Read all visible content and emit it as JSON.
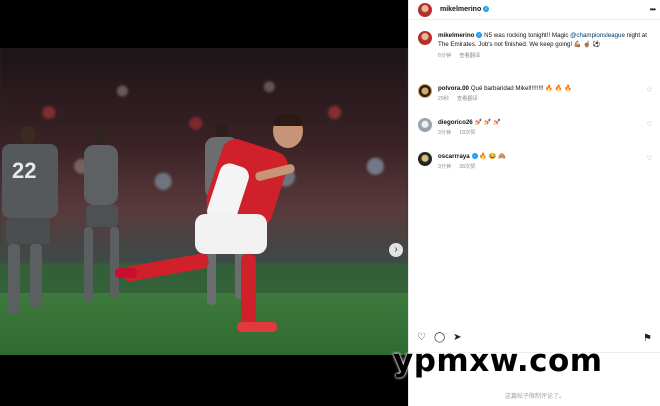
{
  "post": {
    "author": "mikelmerino",
    "caption_author": "mikelmerino",
    "caption_part1": " N5 was rocking tonight!! Magic ",
    "caption_mention": "@championsleague",
    "caption_part2": " night at The Emirates. Job's not finished. We keep going! 💪🏽 ☝🏽 ⚽",
    "caption_time": "6分钟",
    "caption_translate": "查看翻译",
    "media_slides": 4,
    "active_slide": 2
  },
  "comments": [
    {
      "user": "polvora.00",
      "text": "Qué barbaridad Mikel!!!!!!!! 🔥 🔥 🔥",
      "time": "29秒",
      "extra": "查看翻译",
      "verified": false
    },
    {
      "user": "diegorico26",
      "text": "💅🏻 💅🏻 💅🏻",
      "time": "3分钟",
      "extra": "18次赞",
      "verified": false
    },
    {
      "user": "oscarrraya",
      "text": "🔥 😂 🙈",
      "time": "3分钟",
      "extra": "28次赞",
      "verified": true
    }
  ],
  "footer": {
    "disabled_note": "这篇帖子限制评论了。"
  },
  "watermark": "ypmxw.com",
  "jersey_number": "22",
  "icons": {
    "more": "more-horizontal-icon",
    "heart": "heart-icon",
    "comment": "comment-icon",
    "share": "send-icon",
    "bookmark": "bookmark-icon",
    "next": "chevron-right-icon"
  },
  "colors": {
    "accent_link": "#00376b",
    "verified": "#1d9bf0",
    "arsenal_red": "#d0202a"
  }
}
